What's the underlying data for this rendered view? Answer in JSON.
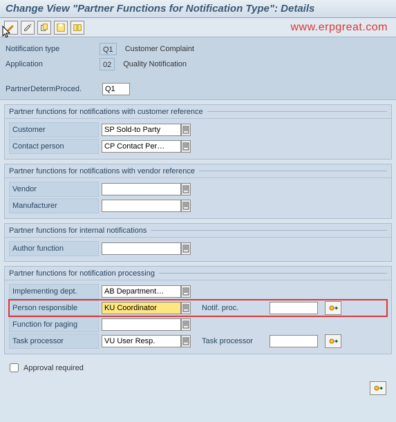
{
  "title": "Change View \"Partner Functions for Notification Type\": Details",
  "watermark": "www.erpgreat.com",
  "header": {
    "notif_type_label": "Notification type",
    "notif_type_value": "Q1",
    "notif_type_desc": "Customer Complaint",
    "application_label": "Application",
    "application_value": "02",
    "application_desc": "Quality Notification",
    "proced_label": "PartnerDetermProced.",
    "proced_value": "Q1"
  },
  "group1": {
    "title": "Partner functions for notifications with customer reference",
    "customer_label": "Customer",
    "customer_value": "SP Sold-to Party",
    "contact_label": "Contact person",
    "contact_value": "CP Contact Per…"
  },
  "group2": {
    "title": "Partner functions for notifications with vendor reference",
    "vendor_label": "Vendor",
    "vendor_value": "",
    "manufacturer_label": "Manufacturer",
    "manufacturer_value": ""
  },
  "group3": {
    "title": "Partner functions for internal notifications",
    "author_label": "Author function",
    "author_value": ""
  },
  "group4": {
    "title": "Partner functions for notification processing",
    "dept_label": "Implementing dept.",
    "dept_value": "AB Department…",
    "person_label": "Person responsible",
    "person_value": "KU Coordinator",
    "notif_proc_label": "Notif. proc.",
    "notif_proc_value": "",
    "paging_label": "Function for paging",
    "paging_value": "",
    "task_label": "Task processor",
    "task_value": "VU User Resp.",
    "task2_label": "Task processor",
    "task2_value": ""
  },
  "approval_label": "Approval required"
}
